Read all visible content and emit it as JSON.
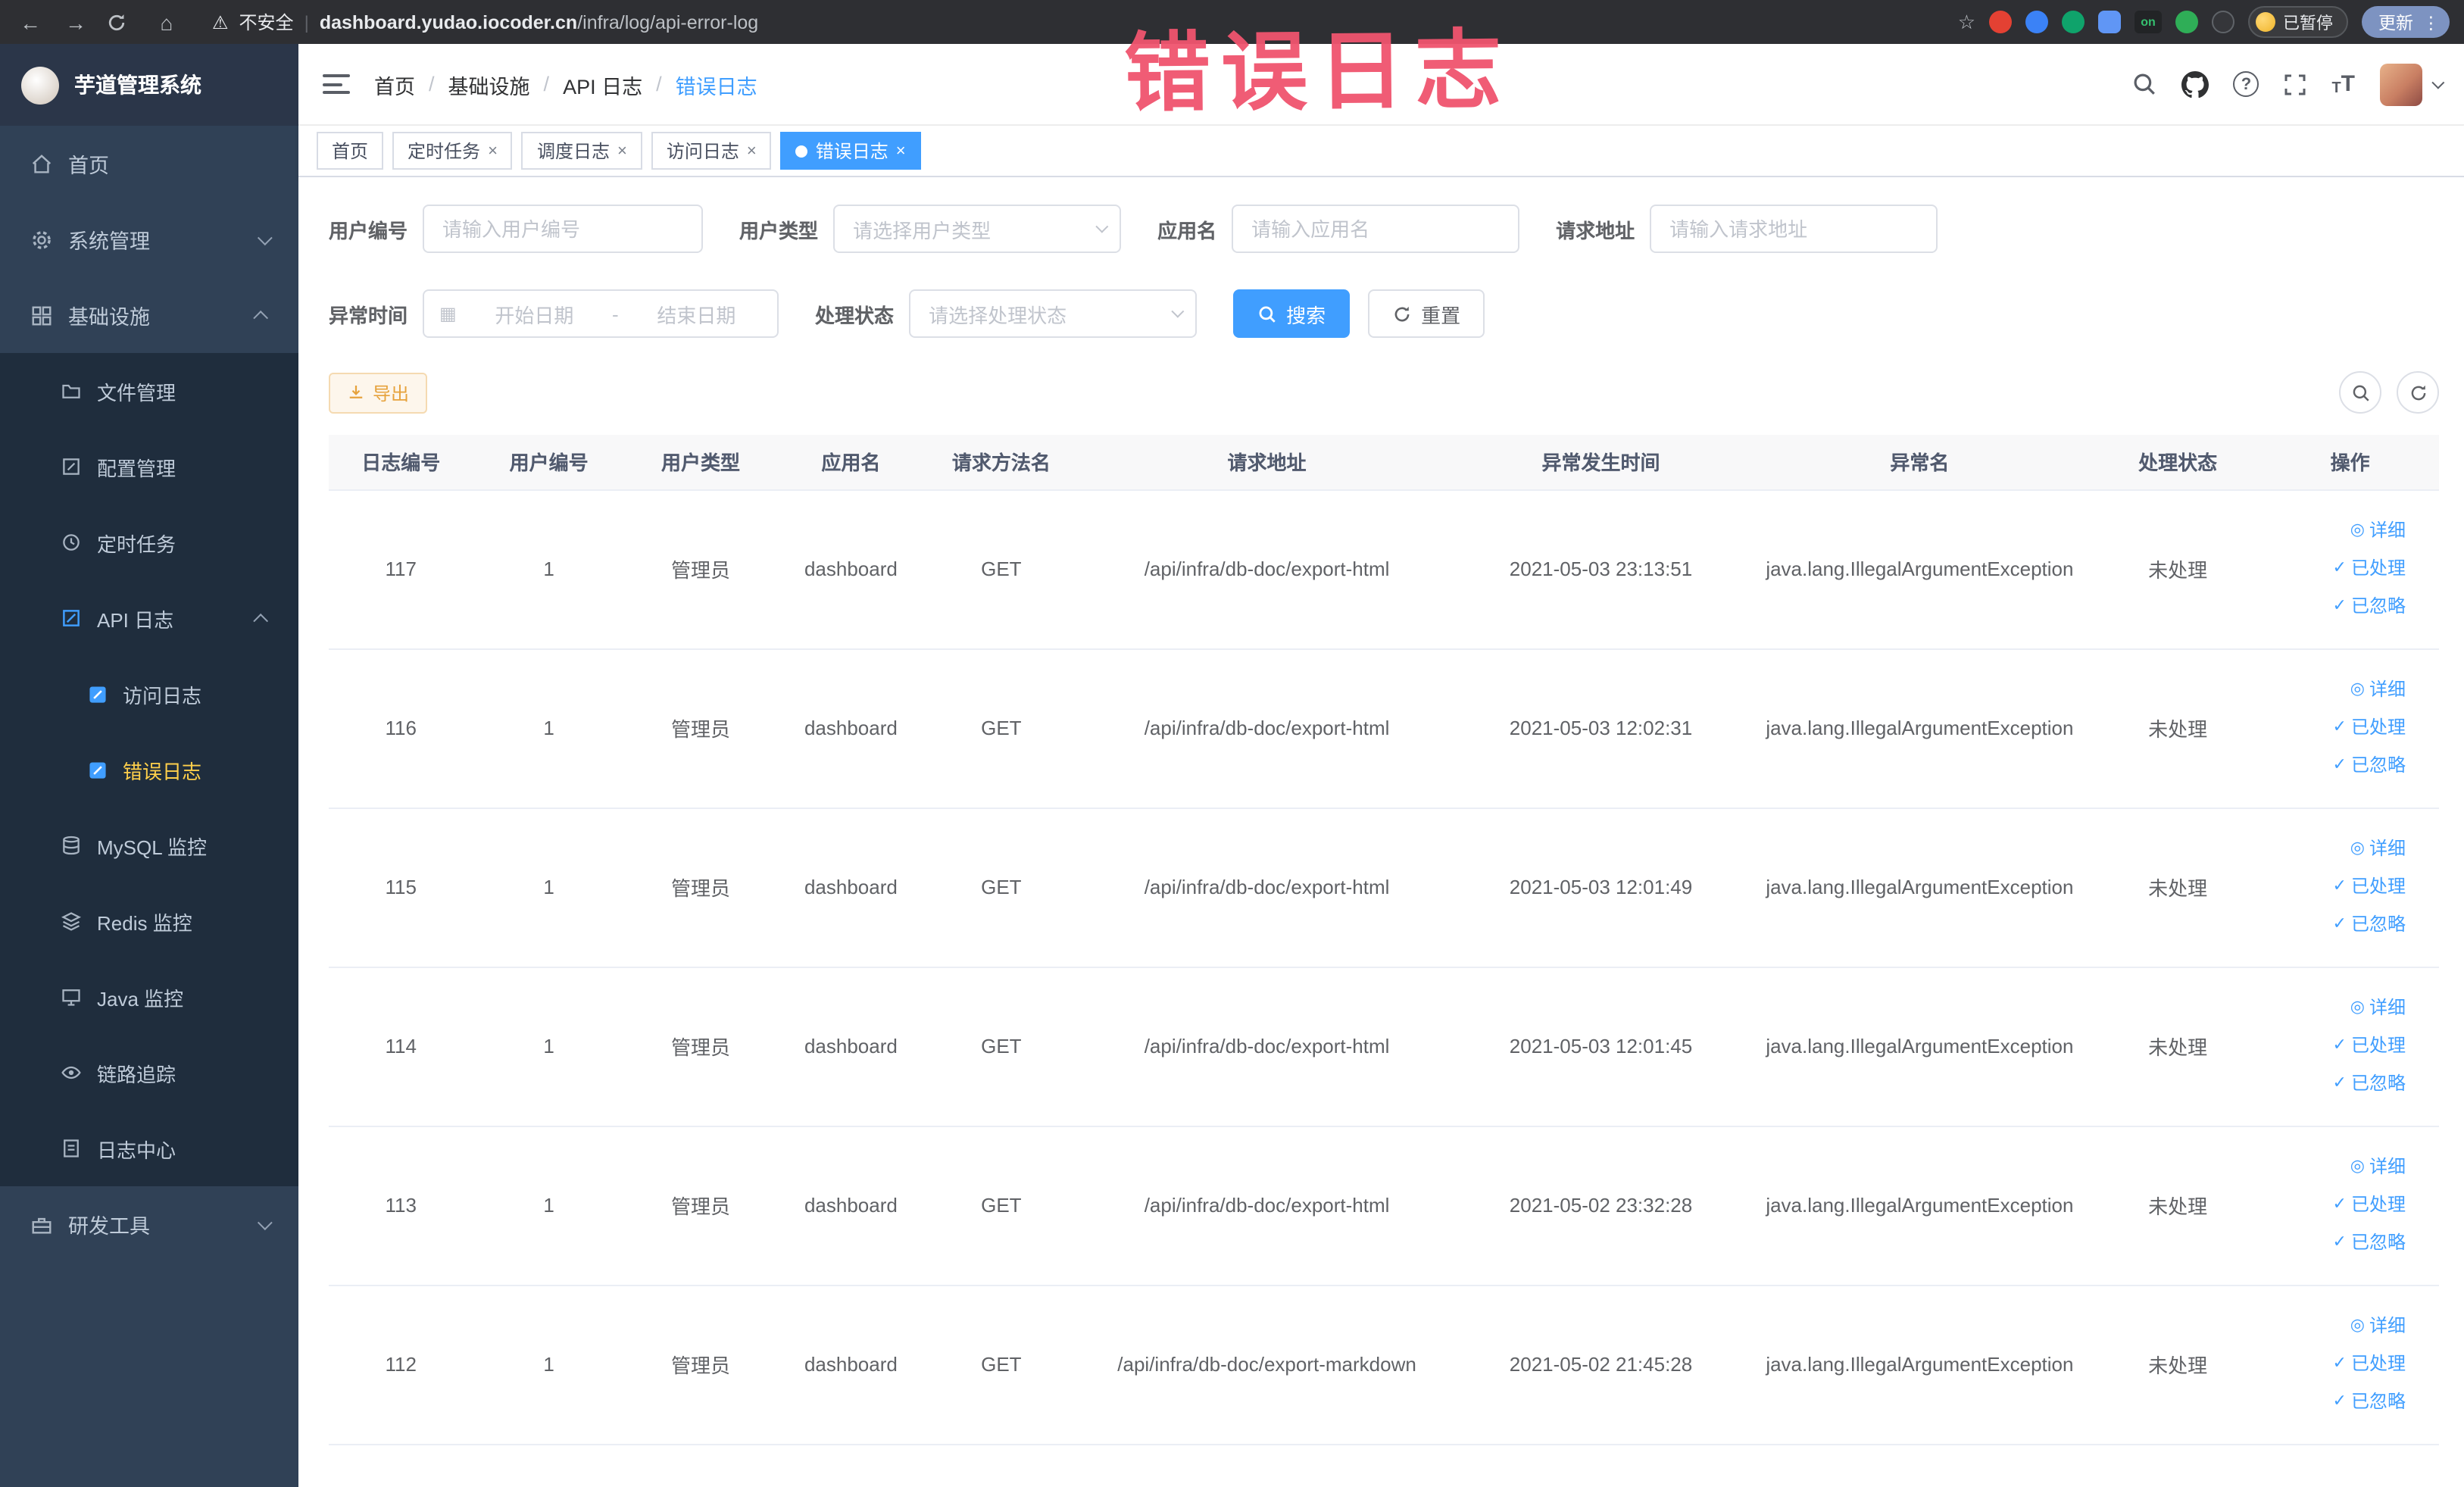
{
  "browser": {
    "security_warning": "不安全",
    "url_separator": "|",
    "url_domain": "dashboard.yudao.iocoder.cn",
    "url_path": "/infra/log/api-error-log",
    "ext_on": "on",
    "paused_badge": "已暂停",
    "update_button": "更新"
  },
  "annotation": {
    "title": "错误日志"
  },
  "sidebar": {
    "logo_title": "芋道管理系统",
    "items": [
      {
        "label": "首页"
      },
      {
        "label": "系统管理"
      },
      {
        "label": "基础设施"
      },
      {
        "label": "文件管理"
      },
      {
        "label": "配置管理"
      },
      {
        "label": "定时任务"
      },
      {
        "label": "API 日志"
      },
      {
        "label": "访问日志"
      },
      {
        "label": "错误日志"
      },
      {
        "label": "MySQL 监控"
      },
      {
        "label": "Redis 监控"
      },
      {
        "label": "Java 监控"
      },
      {
        "label": "链路追踪"
      },
      {
        "label": "日志中心"
      },
      {
        "label": "研发工具"
      }
    ]
  },
  "header": {
    "breadcrumb": [
      "首页",
      "基础设施",
      "API 日志",
      "错误日志"
    ],
    "separator": "/"
  },
  "tabs": [
    {
      "label": "首页"
    },
    {
      "label": "定时任务"
    },
    {
      "label": "调度日志"
    },
    {
      "label": "访问日志"
    },
    {
      "label": "错误日志"
    }
  ],
  "filters": {
    "user_id_label": "用户编号",
    "user_id_placeholder": "请输入用户编号",
    "user_type_label": "用户类型",
    "user_type_placeholder": "请选择用户类型",
    "app_name_label": "应用名",
    "app_name_placeholder": "请输入应用名",
    "request_url_label": "请求地址",
    "request_url_placeholder": "请输入请求地址",
    "exception_time_label": "异常时间",
    "date_start_placeholder": "开始日期",
    "date_separator": "-",
    "date_end_placeholder": "结束日期",
    "process_status_label": "处理状态",
    "process_status_placeholder": "请选择处理状态",
    "search_button": "搜索",
    "reset_button": "重置"
  },
  "toolbar": {
    "export_label": "导出"
  },
  "table": {
    "columns": [
      "日志编号",
      "用户编号",
      "用户类型",
      "应用名",
      "请求方法名",
      "请求地址",
      "异常发生时间",
      "异常名",
      "处理状态",
      "操作"
    ],
    "actions": {
      "detail": "详细",
      "processed": "已处理",
      "ignored": "已忽略"
    },
    "rows": [
      {
        "id": "117",
        "user_id": "1",
        "user_type": "管理员",
        "app": "dashboard",
        "method": "GET",
        "url": "/api/infra/db-doc/export-html",
        "time": "2021-05-03 23:13:51",
        "exception": "java.lang.IllegalArgumentException",
        "status": "未处理"
      },
      {
        "id": "116",
        "user_id": "1",
        "user_type": "管理员",
        "app": "dashboard",
        "method": "GET",
        "url": "/api/infra/db-doc/export-html",
        "time": "2021-05-03 12:02:31",
        "exception": "java.lang.IllegalArgumentException",
        "status": "未处理"
      },
      {
        "id": "115",
        "user_id": "1",
        "user_type": "管理员",
        "app": "dashboard",
        "method": "GET",
        "url": "/api/infra/db-doc/export-html",
        "time": "2021-05-03 12:01:49",
        "exception": "java.lang.IllegalArgumentException",
        "status": "未处理"
      },
      {
        "id": "114",
        "user_id": "1",
        "user_type": "管理员",
        "app": "dashboard",
        "method": "GET",
        "url": "/api/infra/db-doc/export-html",
        "time": "2021-05-03 12:01:45",
        "exception": "java.lang.IllegalArgumentException",
        "status": "未处理"
      },
      {
        "id": "113",
        "user_id": "1",
        "user_type": "管理员",
        "app": "dashboard",
        "method": "GET",
        "url": "/api/infra/db-doc/export-html",
        "time": "2021-05-02 23:32:28",
        "exception": "java.lang.IllegalArgumentException",
        "status": "未处理"
      },
      {
        "id": "112",
        "user_id": "1",
        "user_type": "管理员",
        "app": "dashboard",
        "method": "GET",
        "url": "/api/infra/db-doc/export-markdown",
        "time": "2021-05-02 21:45:28",
        "exception": "java.lang.IllegalArgumentException",
        "status": "未处理"
      }
    ]
  },
  "icons": {
    "back": "←",
    "forward": "→",
    "home": "⌂",
    "warning": "⚠",
    "star": "☆",
    "kebab": "⋮",
    "close": "×",
    "check": "✓",
    "eye": "◎",
    "calendar": "▦",
    "question": "?",
    "t_small": "T",
    "t_large": "T"
  },
  "colors": {
    "primary": "#409eff",
    "warning": "#e6a23c",
    "menu_active": "#ffd04b",
    "annotation": "#f0546e",
    "sidebar_bg": "#304156",
    "submenu_bg": "#1f2d3d"
  }
}
